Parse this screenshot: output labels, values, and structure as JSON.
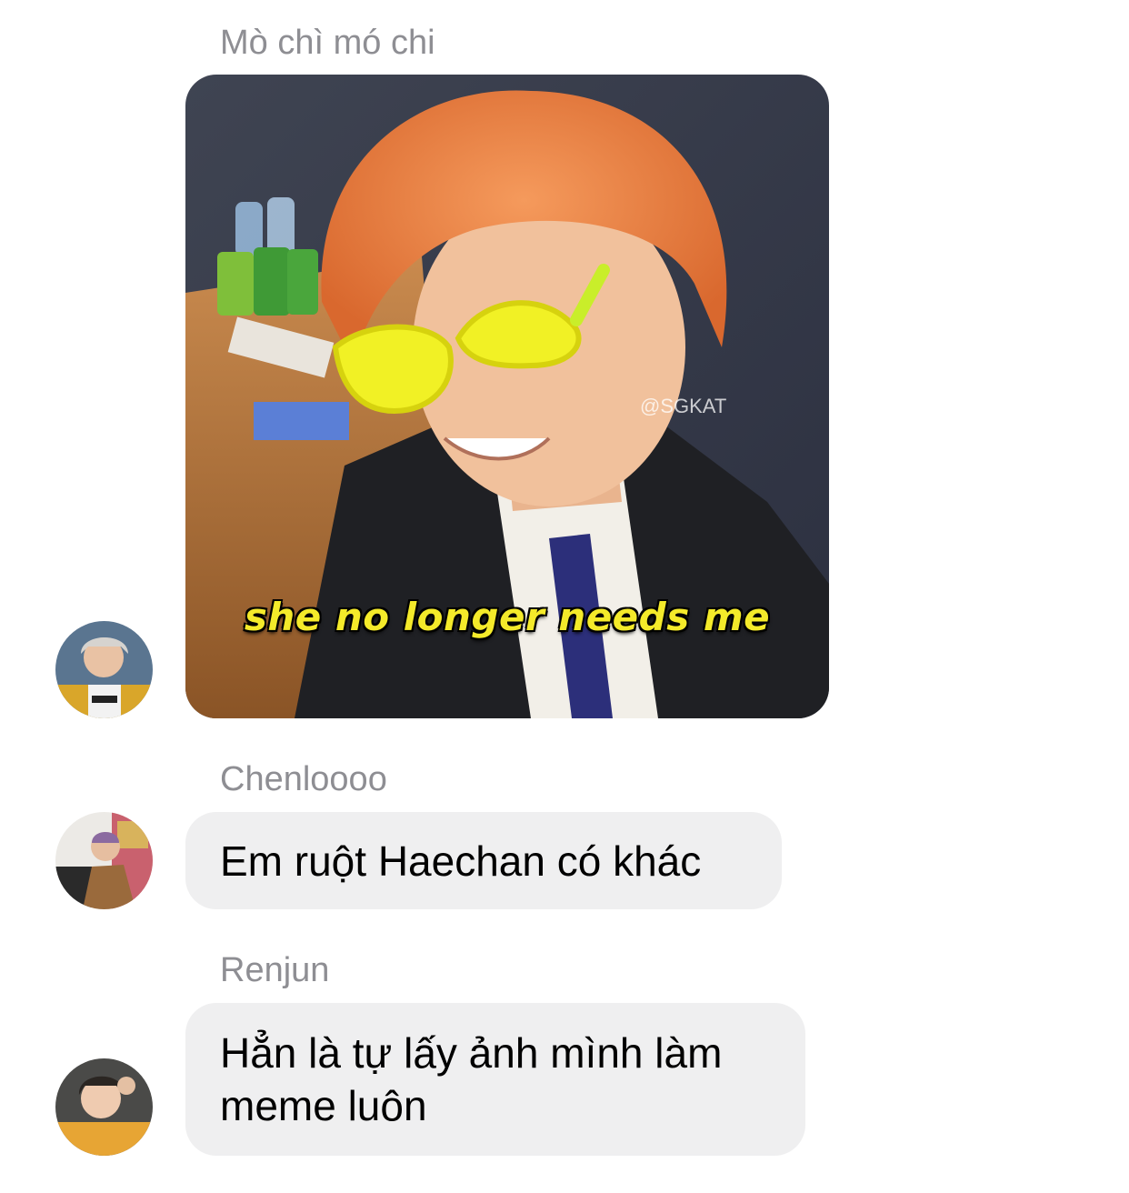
{
  "messages": [
    {
      "sender": "Mò chì mó chi",
      "type": "image",
      "image": {
        "caption": "she no longer needs me",
        "watermark": "@SGKAT"
      }
    },
    {
      "sender": "Chenloooo",
      "type": "text",
      "text": "Em ruột Haechan có khác"
    },
    {
      "sender": "Renjun",
      "type": "text",
      "text": "Hẳn là tự lấy ảnh mình làm meme luôn"
    }
  ],
  "colors": {
    "bubble_bg": "#efeff0",
    "sender_name": "#8e8e93",
    "caption_yellow": "#f4ea2a"
  }
}
